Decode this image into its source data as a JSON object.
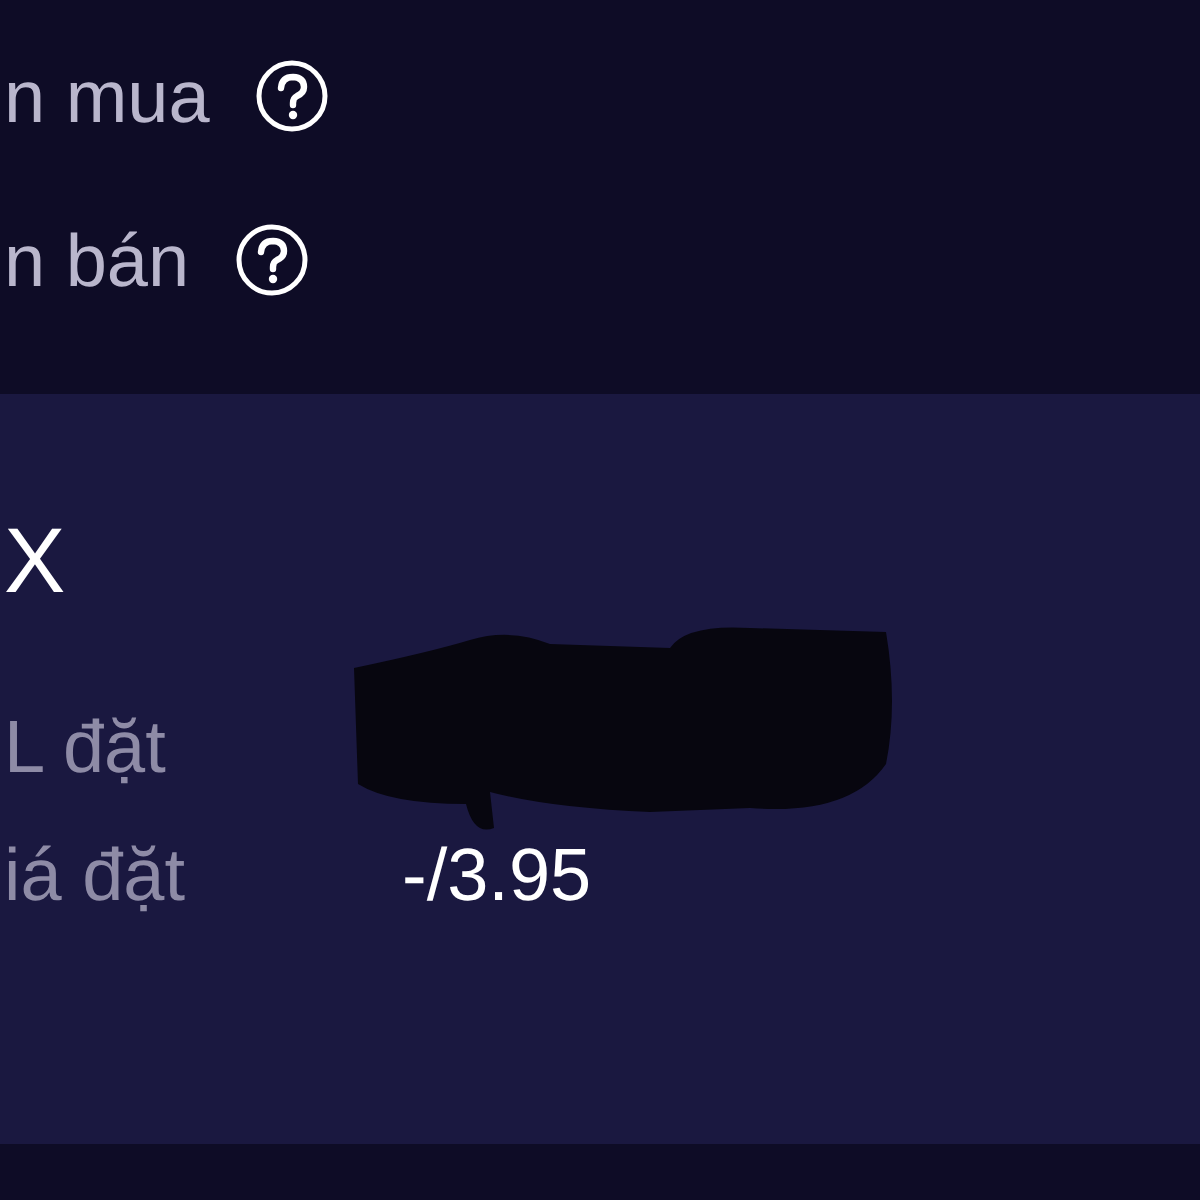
{
  "options": [
    {
      "label": "n mua"
    },
    {
      "label": "n bán"
    }
  ],
  "order_card": {
    "title": "X",
    "fields": [
      {
        "label": "L đặt"
      },
      {
        "label": "iá đặt",
        "value": "-/3.95"
      }
    ]
  }
}
